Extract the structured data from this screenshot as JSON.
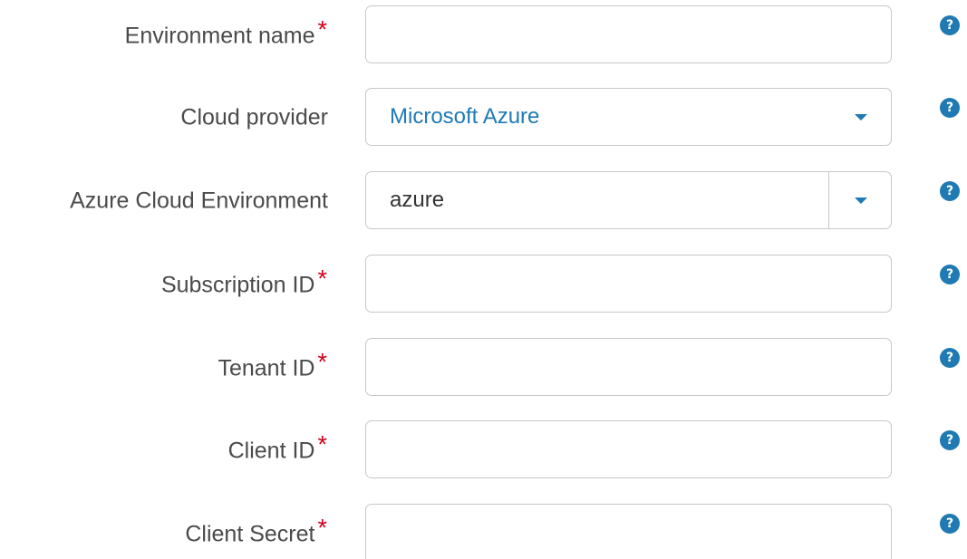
{
  "form": {
    "required_marker": "*",
    "help_icon_glyph": "?",
    "accent_color": "#1f7ab3",
    "required_color": "#d0021b",
    "fields": {
      "environment_name": {
        "label": "Environment name",
        "value": "",
        "placeholder": ""
      },
      "cloud_provider": {
        "label": "Cloud provider",
        "selected": "Microsoft Azure"
      },
      "azure_cloud_environment": {
        "label": "Azure Cloud Environment",
        "selected": "azure"
      },
      "subscription_id": {
        "label": "Subscription ID",
        "value": "",
        "placeholder": ""
      },
      "tenant_id": {
        "label": "Tenant ID",
        "value": "",
        "placeholder": ""
      },
      "client_id": {
        "label": "Client ID",
        "value": "",
        "placeholder": ""
      },
      "client_secret": {
        "label": "Client Secret",
        "value": "",
        "placeholder": ""
      }
    }
  }
}
